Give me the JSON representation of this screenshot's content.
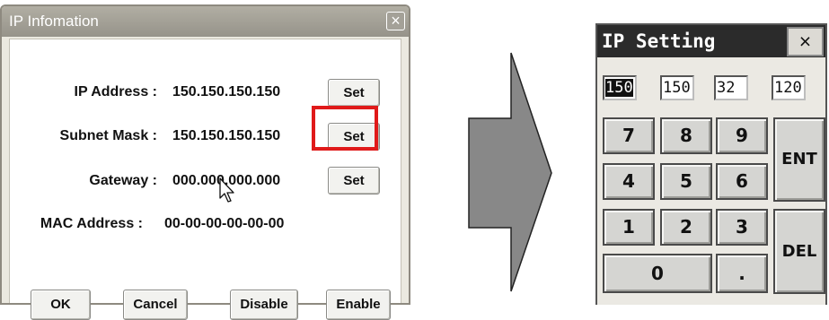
{
  "ip_info_dialog": {
    "title": "IP Infomation",
    "close_label": "×",
    "rows": [
      {
        "label": "IP Address :",
        "value": "150.150.150.150",
        "set_label": "Set"
      },
      {
        "label": "Subnet Mask :",
        "value": "150.150.150.150",
        "set_label": "Set"
      },
      {
        "label": "Gateway :",
        "value": "000.000.000.000",
        "set_label": "Set"
      },
      {
        "label": "MAC Address :",
        "value": "00-00-00-00-00-00"
      }
    ],
    "buttons": {
      "ok": "OK",
      "cancel": "Cancel",
      "disable": "Disable",
      "enable": "Enable"
    },
    "highlight_color": "#e01a1a"
  },
  "ip_setting_dialog": {
    "title": "IP Setting",
    "close_label": "×",
    "octets": [
      "150",
      "150",
      "32",
      "120"
    ],
    "keys": {
      "k7": "7",
      "k8": "8",
      "k9": "9",
      "k4": "4",
      "k5": "5",
      "k6": "6",
      "k1": "1",
      "k2": "2",
      "k3": "3",
      "k0": "0",
      "dot": ".",
      "ent": "ENT",
      "del": "DEL"
    }
  },
  "icons": {
    "cursor": "mouse-pointer-icon",
    "arrow": "right-arrow-icon"
  },
  "colors": {
    "dialog_bg": "#ebe9e0",
    "keypad_title_bg": "#2b2b2b",
    "arrow_fill": "#888888"
  }
}
